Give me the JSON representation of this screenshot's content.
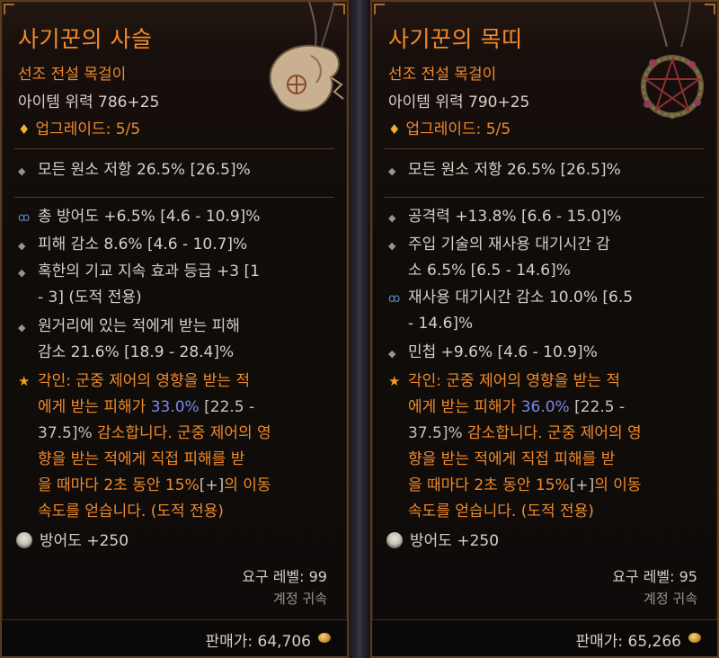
{
  "tooltips": [
    {
      "name": "사기꾼의 사슬",
      "type": "선조 전설 목걸이",
      "power": "아이템 위력 786+25",
      "upgrade": "업그레이드: 5/5",
      "implicit": "모든 원소 저항 26.5% [26.5]%",
      "affixes": [
        {
          "text": "총 방어도 +6.5% [4.6 - 10.9]%",
          "icon": "blue-swirl-icon"
        },
        {
          "text": "피해 감소 8.6% [4.6 - 10.7]%",
          "icon": "diamond-bullet-icon"
        },
        {
          "line1": "혹한의 기교 지속 효과 등급 +3 [1",
          "line2": "- 3] (도적 전용)",
          "icon": "diamond-bullet-icon"
        },
        {
          "line1": "원거리에 있는 적에게 받는 피해",
          "line2": "감소 21.6% [18.9 - 28.4]%",
          "icon": "diamond-bullet-icon"
        }
      ],
      "aspect": {
        "l1": "각인: 군중 제어의 영향을 받는 적",
        "l2a": "에게 받는 피해가 ",
        "l2b": "33.0%",
        "l2c": " [22.5 -",
        "l3a": "37.5]%",
        "l3b": " 감소합니다. 군중 제어의 영",
        "l4": "향을 받는 적에게 직접 피해를 받",
        "l5a": "을 때마다 2초 동안 15%",
        "l5b": "[+]",
        "l5c": "의 이동",
        "l6": "속도를 얻습니다. (도적 전용)"
      },
      "armor": "방어도 +250",
      "required_level": "요구 레벨: 99",
      "bound": "계정 귀속",
      "sell_price": "판매가: 64,706"
    },
    {
      "name": "사기꾼의 목띠",
      "type": "선조 전설 목걸이",
      "power": "아이템 위력 790+25",
      "upgrade": "업그레이드: 5/5",
      "implicit": "모든 원소 저항 26.5% [26.5]%",
      "affixes": [
        {
          "text": "공격력 +13.8% [6.6 - 15.0]%",
          "icon": "diamond-bullet-icon"
        },
        {
          "line1": "주입 기술의 재사용 대기시간 감",
          "line2": "소 6.5% [6.5 - 14.6]%",
          "icon": "diamond-bullet-icon"
        },
        {
          "line1": "재사용 대기시간 감소 10.0% [6.5",
          "line2": "- 14.6]%",
          "icon": "blue-swirl-icon"
        },
        {
          "text": "민첩 +9.6% [4.6 - 10.9]%",
          "icon": "diamond-bullet-icon"
        }
      ],
      "aspect": {
        "l1": "각인: 군중 제어의 영향을 받는 적",
        "l2a": "에게 받는 피해가 ",
        "l2b": "36.0%",
        "l2c": " [22.5 -",
        "l3a": "37.5]%",
        "l3b": " 감소합니다. 군중 제어의 영",
        "l4": "향을 받는 적에게 직접 피해를 받",
        "l5a": "을 때마다 2초 동안 15%",
        "l5b": "[+]",
        "l5c": "의 이동",
        "l6": "속도를 얻습니다. (도적 전용)"
      },
      "armor": "방어도 +250",
      "required_level": "요구 레벨: 95",
      "bound": "계정 귀속",
      "sell_price": "판매가: 65,266"
    }
  ],
  "colors": {
    "legendary_orange": "#f08a2c",
    "text_light": "#d6d0c6",
    "aspect_value_blue": "#7a86e8",
    "border_brown": "#5b3a20"
  }
}
